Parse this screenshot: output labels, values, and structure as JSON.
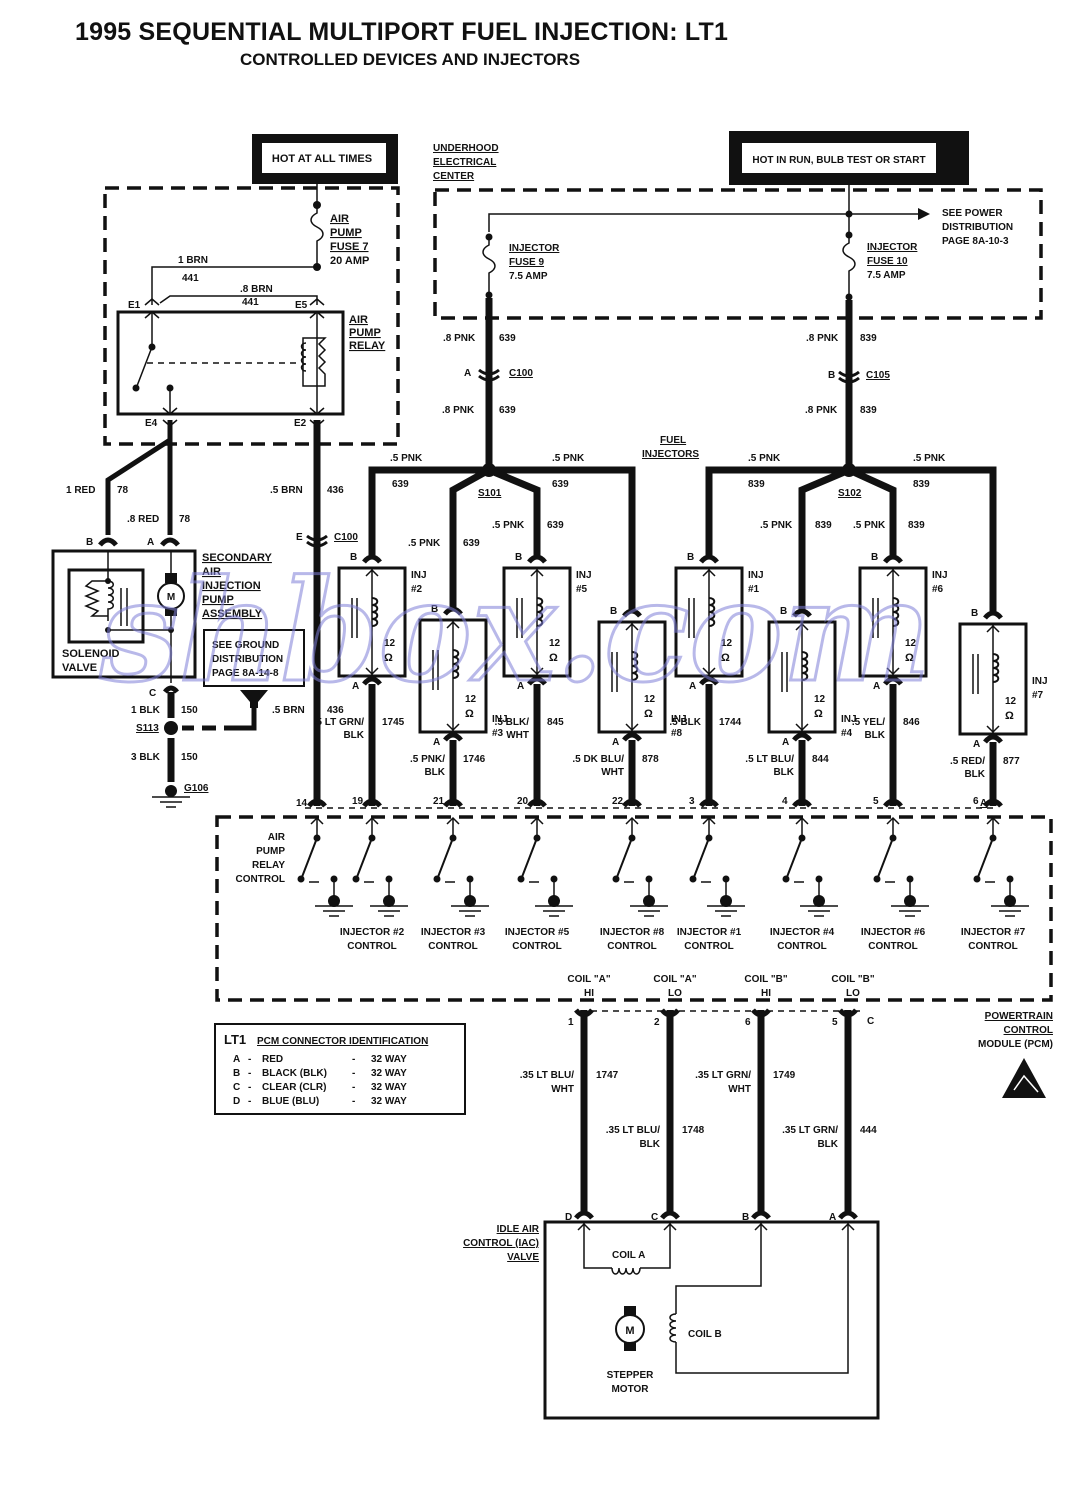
{
  "header": {
    "title": "1995 SEQUENTIAL MULTIPORT FUEL INJECTION: LT1",
    "subtitle": "CONTROLLED DEVICES AND INJECTORS"
  },
  "power": {
    "hot_at_all_times": "HOT AT ALL TIMES",
    "hot_in_run": "HOT IN RUN, BULB TEST OR START",
    "underhood": [
      "UNDERHOOD",
      "ELECTRICAL",
      "CENTER"
    ],
    "see_power": [
      "SEE POWER",
      "DISTRIBUTION",
      "PAGE 8A-10-3"
    ],
    "fuse9": [
      "INJECTOR",
      "FUSE 9",
      "7.5 AMP"
    ],
    "fuse10": [
      "INJECTOR",
      "FUSE 10",
      "7.5 AMP"
    ],
    "fuse7": [
      "AIR",
      "PUMP",
      "FUSE 7",
      "20 AMP"
    ]
  },
  "relay": {
    "label": [
      "AIR",
      "PUMP",
      "RELAY"
    ],
    "pins": {
      "e1": "E1",
      "e5": "E5",
      "e4": "E4",
      "e2": "E2"
    },
    "wire_top_1": {
      "gauge": "1 BRN",
      "circuit": "441"
    },
    "wire_top_2": {
      "gauge": ".8 BRN",
      "circuit": "441"
    }
  },
  "air_pump": {
    "label": [
      "SECONDARY",
      "AIR",
      "INJECTION",
      "PUMP",
      "ASSEMBLY"
    ],
    "solenoid": [
      "SOLENOID",
      "VALVE"
    ],
    "motor": "M",
    "pin_b": "B",
    "pin_a": "A",
    "pin_c": "C",
    "wire_b": {
      "gauge": "1 RED",
      "circuit": "78"
    },
    "wire_a": {
      "gauge": ".8 RED",
      "circuit": "78"
    },
    "wire_c": {
      "gauge": "1 BLK",
      "circuit": "150"
    },
    "ground_wire": {
      "gauge": "3 BLK",
      "circuit": "150"
    },
    "splice": "S113",
    "ground": "G106",
    "see_ground": [
      "SEE GROUND",
      "DISTRIBUTION",
      "PAGE 8A-14-8"
    ],
    "relay_wire_top": {
      "gauge": ".5 BRN",
      "circuit": "436"
    },
    "relay_wire_bottom": {
      "gauge": ".5 BRN",
      "circuit": "436"
    },
    "connector": {
      "pin": "E",
      "name": "C100"
    }
  },
  "feeds": {
    "left": {
      "gauge": ".8 PNK",
      "circuit": "639",
      "conn_pin": "A",
      "conn": "C100",
      "splice": "S101"
    },
    "right": {
      "gauge": ".8 PNK",
      "circuit": "839",
      "conn_pin": "B",
      "conn": "C105",
      "splice": "S102"
    },
    "branch_gauge": ".5 PNK",
    "fuel_injectors_label": [
      "FUEL",
      "INJECTORS"
    ]
  },
  "injectors": [
    {
      "name": [
        "INJ",
        "#2"
      ],
      "feed": "639",
      "gauge": ".5 LT GRN/BLK",
      "circuit": "1745",
      "pcm_pin": "19",
      "resistance": "12",
      "control": [
        "INJECTOR #2",
        "CONTROL"
      ]
    },
    {
      "name": [
        "INJ",
        "#3"
      ],
      "feed": "639",
      "gauge": ".5 PNK/BLK",
      "circuit": "1746",
      "pcm_pin": "21",
      "resistance": "12",
      "control": [
        "INJECTOR #3",
        "CONTROL"
      ]
    },
    {
      "name": [
        "INJ",
        "#5"
      ],
      "feed": "639",
      "gauge": ".5 BLK/WHT",
      "circuit": "845",
      "pcm_pin": "20",
      "resistance": "12",
      "control": [
        "INJECTOR #5",
        "CONTROL"
      ]
    },
    {
      "name": [
        "INJ",
        "#8"
      ],
      "feed": "639",
      "gauge": ".5 DK BLU/WHT",
      "circuit": "878",
      "pcm_pin": "22",
      "resistance": "12",
      "control": [
        "INJECTOR #8",
        "CONTROL"
      ]
    },
    {
      "name": [
        "INJ",
        "#1"
      ],
      "feed": "839",
      "gauge": ".5 BLK",
      "circuit": "1744",
      "pcm_pin": "3",
      "resistance": "12",
      "control": [
        "INJECTOR #1",
        "CONTROL"
      ]
    },
    {
      "name": [
        "INJ",
        "#4"
      ],
      "feed": "839",
      "gauge": ".5 LT BLU/BLK",
      "circuit": "844",
      "pcm_pin": "4",
      "resistance": "12",
      "control": [
        "INJECTOR #4",
        "CONTROL"
      ]
    },
    {
      "name": [
        "INJ",
        "#6"
      ],
      "feed": "839",
      "gauge": ".5 YEL/BLK",
      "circuit": "846",
      "pcm_pin": "5",
      "resistance": "12",
      "control": [
        "INJECTOR #6",
        "CONTROL"
      ]
    },
    {
      "name": [
        "INJ",
        "#7"
      ],
      "feed": "839",
      "gauge": ".5 RED/BLK",
      "circuit": "877",
      "pcm_pin": "6",
      "resistance": "12",
      "control": [
        "INJECTOR #7",
        "CONTROL"
      ]
    }
  ],
  "pcm": {
    "relay_control": [
      "AIR",
      "PUMP",
      "RELAY",
      "CONTROL"
    ],
    "relay_pin": "14",
    "connector_a": "A",
    "connector_c": "C",
    "label": [
      "POWERTRAIN",
      "CONTROL",
      "MODULE (PCM)"
    ],
    "omega": "Ω",
    "pin_b": "B",
    "pin_a": "A",
    "coils": [
      {
        "label": [
          "COIL \"A\"",
          "HI"
        ],
        "pin": "1",
        "gauge": [
          ".35 LT BLU/",
          "WHT"
        ],
        "circuit": "1747",
        "iac_pin": "D"
      },
      {
        "label": [
          "COIL \"A\"",
          "LO"
        ],
        "pin": "2",
        "gauge": [
          ".35 LT BLU/",
          "BLK"
        ],
        "circuit": "1748",
        "iac_pin": "C"
      },
      {
        "label": [
          "COIL \"B\"",
          "HI"
        ],
        "pin": "6",
        "gauge": [
          ".35 LT GRN/",
          "WHT"
        ],
        "circuit": "1749",
        "iac_pin": "B"
      },
      {
        "label": [
          "COIL \"B\"",
          "LO"
        ],
        "pin": "5",
        "gauge": [
          ".35 LT GRN/",
          "BLK"
        ],
        "circuit": "444",
        "iac_pin": "A"
      }
    ]
  },
  "connector_id": {
    "heading_prefix": "LT1",
    "heading": "PCM CONNECTOR IDENTIFICATION",
    "rows": [
      {
        "key": "A",
        "color": "RED",
        "ways": "32 WAY"
      },
      {
        "key": "B",
        "color": "BLACK (BLK)",
        "ways": "32 WAY"
      },
      {
        "key": "C",
        "color": "CLEAR (CLR)",
        "ways": "32 WAY"
      },
      {
        "key": "D",
        "color": "BLUE (BLU)",
        "ways": "32 WAY"
      }
    ]
  },
  "iac": {
    "label": [
      "IDLE AIR",
      "CONTROL (IAC)",
      "VALVE"
    ],
    "coil_a": "COIL A",
    "coil_b": "COIL B",
    "motor": "M",
    "stepper": [
      "STEPPER",
      "MOTOR"
    ]
  },
  "watermark": "shbox.com"
}
